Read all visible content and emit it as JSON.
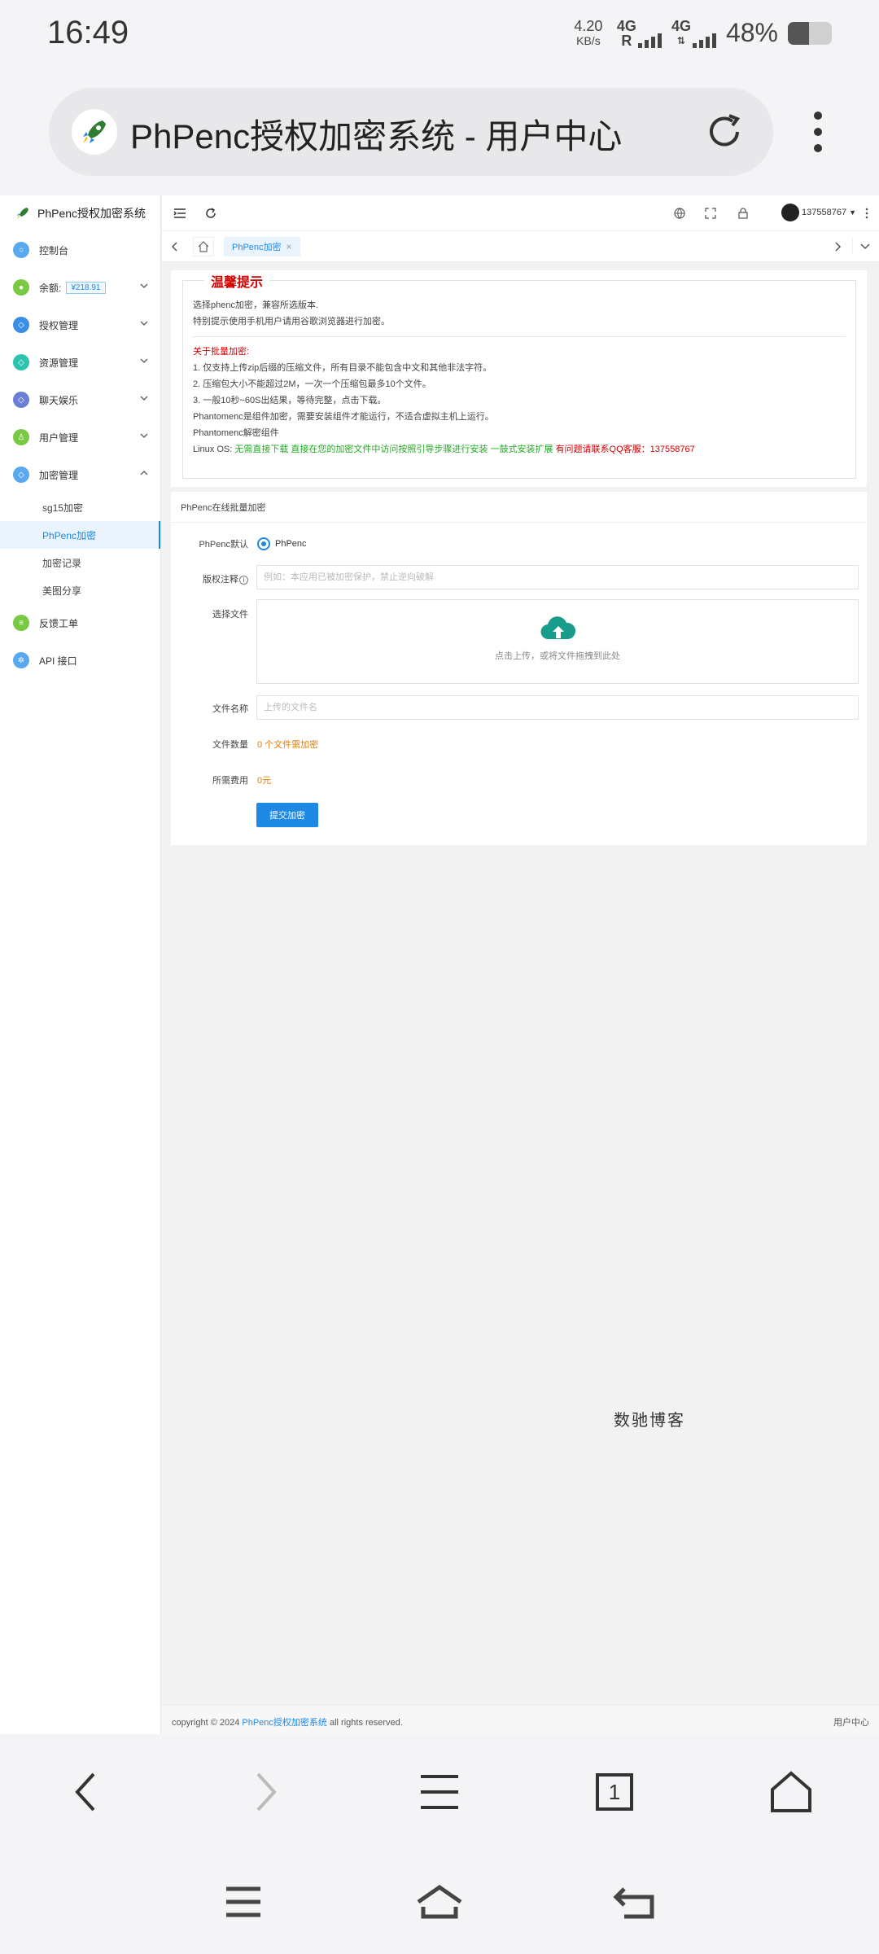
{
  "status_bar": {
    "time": "16:49",
    "net_speed_value": "4.20",
    "net_speed_unit": "KB/s",
    "sim1_type": "4G",
    "sim1_flag": "R",
    "sim2_type": "4G",
    "battery_text": "48%",
    "battery_level": 0.48
  },
  "browser": {
    "page_title": "PhPenc授权加密系统 - 用户中心"
  },
  "app": {
    "brand": "PhPenc授权加密系统",
    "sidebar": {
      "items": [
        {
          "label": "控制台",
          "icon": "dashboard-icon",
          "color": "#5aa9f0"
        },
        {
          "label": "余额:",
          "badge": "¥218.91",
          "icon": "wallet-icon",
          "color": "#7ac943"
        },
        {
          "label": "授权管理",
          "icon": "shield-icon",
          "color": "#3a8ee6"
        },
        {
          "label": "资源管理",
          "icon": "shield-icon",
          "color": "#2cc4b0"
        },
        {
          "label": "聊天娱乐",
          "icon": "shield-icon",
          "color": "#6b7fd7"
        },
        {
          "label": "用户管理",
          "icon": "user-icon",
          "color": "#7ac943"
        },
        {
          "label": "加密管理",
          "icon": "shield-icon",
          "color": "#5aa9f0"
        },
        {
          "label": "反馈工单",
          "icon": "feedback-icon",
          "color": "#7ac943"
        },
        {
          "label": "API 接口",
          "icon": "api-icon",
          "color": "#5aa9f0"
        }
      ],
      "sub_items": [
        "sg15加密",
        "PhPenc加密",
        "加密记录",
        "美图分享"
      ],
      "active_sub": "PhPenc加密"
    },
    "topbar": {
      "username": "137558767"
    },
    "tabs": {
      "active_tab": "PhPenc加密",
      "close_glyph": "×"
    },
    "notice": {
      "title": "温馨提示",
      "line1": "选择phenc加密，兼容所选版本.",
      "line2": "特别提示使用手机用户请用谷歌浏览器进行加密。",
      "batch_heading": "关于批量加密:",
      "rule1": "1. 仅支持上传zip后缀的压缩文件，所有目录不能包含中文和其他非法字符。",
      "rule2": "2. 压缩包大小不能超过2M，一次一个压缩包最多10个文件。",
      "rule3": "3. 一般10秒~60S出结果，等待完整，点击下载。",
      "rule4": "Phantomenc是组件加密，需要安装组件才能运行，不适合虚拟主机上运行。",
      "rule5": "Phantomenc解密组件",
      "linux_label": "Linux OS:",
      "linux_green": "无需直接下载 直接在您的加密文件中访问按照引导步骤进行安装 一鼓式安装扩展",
      "linux_red": "有问题请联系QQ客服：137558767"
    },
    "form": {
      "header": "PhPenc在线批量加密",
      "default_label": "PhPenc默认",
      "radio_option": "PhPenc",
      "copyright_label": "版权注释",
      "copyright_placeholder": "例如：本应用已被加密保护，禁止逆向破解",
      "file_label": "选择文件",
      "upload_hint": "点击上传，或将文件拖拽到此处",
      "filename_label": "文件名称",
      "filename_placeholder": "上传的文件名",
      "count_label": "文件数量",
      "count_value": "0 个文件需加密",
      "fee_label": "所需费用",
      "fee_value": "0元",
      "submit": "提交加密"
    },
    "watermark": "数驰博客",
    "footer": {
      "copyright_prefix": "copyright © 2024",
      "site_link": "PhPenc授权加密系统",
      "rights": "all rights reserved.",
      "right_text": "用户中心"
    }
  },
  "bottom_nav": {
    "tab_count": "1"
  }
}
